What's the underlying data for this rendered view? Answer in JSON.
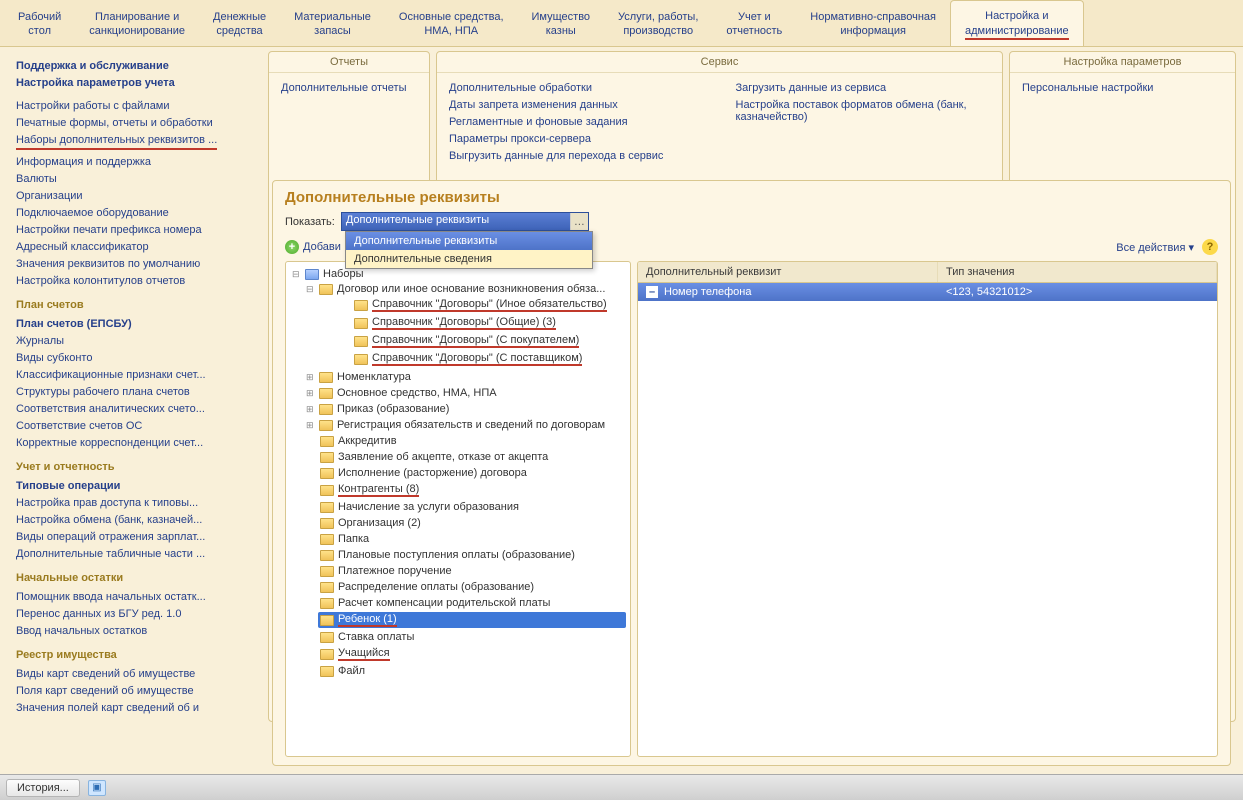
{
  "main_tabs": [
    "Рабочий\nстол",
    "Планирование и\nсанкционирование",
    "Денежные\nсредства",
    "Материальные\nзапасы",
    "Основные средства,\nНМА, НПА",
    "Имущество\nказны",
    "Услуги, работы,\nпроизводство",
    "Учет и\nотчетность",
    "Нормативно-справочная\nинформация",
    "Настройка и\nадминистрирование"
  ],
  "main_tab_active_index": 9,
  "sidebar": {
    "s1": {
      "title": "Поддержка и обслуживание"
    },
    "s2": {
      "title": "Настройка параметров учета"
    },
    "links1": [
      "Настройки работы с файлами",
      "Печатные формы, отчеты и обработки",
      "Наборы дополнительных реквизитов ...",
      "Информация и поддержка",
      "Валюты",
      "Организации",
      "Подключаемое оборудование",
      "Настройки печати префикса номера",
      "Адресный классификатор",
      "Значения реквизитов по умолчанию",
      "Настройка колонтитулов отчетов"
    ],
    "s3": {
      "title": "План счетов"
    },
    "links3": [
      "План счетов (ЕПСБУ)",
      "Журналы",
      "Виды субконто",
      "Классификационные признаки счет...",
      "Структуры рабочего плана счетов",
      "Соответствия аналитических счето...",
      "Соответствие счетов ОС",
      "Корректные корреспонденции счет..."
    ],
    "s4": {
      "title": "Учет и отчетность"
    },
    "links4": [
      "Типовые операции",
      "Настройка прав доступа к типовы...",
      "Настройка обмена (банк, казначей...",
      "Виды операций отражения зарплат...",
      "Дополнительные табличные части ..."
    ],
    "s5": {
      "title": "Начальные остатки"
    },
    "links5": [
      "Помощник ввода начальных остатк...",
      "Перенос данных из БГУ ред. 1.0",
      "Ввод начальных остатков"
    ],
    "s6": {
      "title": "Реестр имущества"
    },
    "links6": [
      "Виды карт сведений об имуществе",
      "Поля карт сведений об имуществе",
      "Значения полей карт сведений об и"
    ]
  },
  "panels": {
    "reports": {
      "title": "Отчеты",
      "items": [
        "Дополнительные отчеты"
      ]
    },
    "service": {
      "title": "Сервис",
      "col1": [
        "Дополнительные обработки",
        "Даты запрета изменения данных",
        "Регламентные и фоновые задания",
        "Параметры прокси-сервера",
        "Выгрузить данные для перехода в сервис"
      ],
      "col2": [
        "Загрузить данные из сервиса",
        "Настройка поставок форматов обмена (банк, казначейство)"
      ]
    },
    "settings": {
      "title": "Настройка параметров",
      "items": [
        "Персональные настройки"
      ]
    }
  },
  "work": {
    "title": "Дополнительные реквизиты",
    "filter_label": "Показать:",
    "filter_value": "Дополнительные реквизиты",
    "dropdown": [
      "Дополнительные реквизиты",
      "Дополнительные сведения"
    ],
    "add_button": "Добави",
    "all_actions": "Все действия",
    "tree": {
      "root": "Наборы",
      "n1": "Договор или иное основание возникновения обяза...",
      "n1c": [
        "Справочник \"Договоры\" (Иное обязательство)",
        "Справочник \"Договоры\" (Общие) (3)",
        "Справочник \"Договоры\" (С покупателем)",
        "Справочник \"Договоры\" (С поставщиком)"
      ],
      "rest": [
        "Номенклатура",
        "Основное средство, НМА, НПА",
        "Приказ (образование)",
        "Регистрация обязательств и сведений по договорам",
        "Аккредитив",
        "Заявление об акцепте, отказе от акцепта",
        "Исполнение (расторжение) договора",
        "Контрагенты (8)",
        "Начисление за услуги образования",
        "Организация (2)",
        "Папка",
        "Плановые поступления оплаты (образование)",
        "Платежное поручение",
        "Распределение оплаты (образование)",
        "Расчет компенсации родительской платы",
        "Ребенок (1)",
        "Ставка оплаты",
        "Учащийся",
        "Файл"
      ]
    },
    "table": {
      "col1": "Дополнительный реквизит",
      "col2": "Тип значения",
      "row1_c1": "Номер телефона",
      "row1_c2": "<123, 54321012>"
    }
  },
  "status": {
    "history": "История..."
  }
}
